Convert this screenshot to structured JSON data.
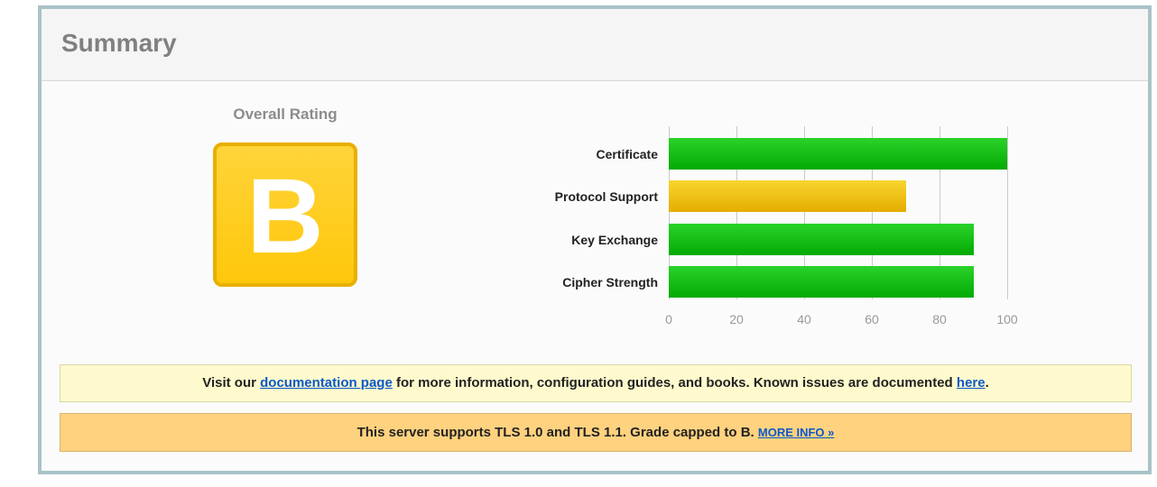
{
  "summary": {
    "title": "Summary",
    "overall_rating_label": "Overall Rating",
    "grade": "B",
    "grade_color": "#ffc70a"
  },
  "chart_data": {
    "type": "bar",
    "orientation": "horizontal",
    "categories": [
      "Certificate",
      "Protocol Support",
      "Key Exchange",
      "Cipher Strength"
    ],
    "values": [
      100,
      70,
      90,
      90
    ],
    "bar_colors": [
      "#16c016",
      "#f0c010",
      "#16c016",
      "#16c016"
    ],
    "xlim": [
      0,
      100
    ],
    "xticks": [
      0,
      20,
      40,
      60,
      80,
      100
    ],
    "grid": true,
    "title": "",
    "xlabel": "",
    "ylabel": ""
  },
  "notices": {
    "doc": {
      "prefix": "Visit our ",
      "link1": "documentation page",
      "middle": " for more information, configuration guides, and books. Known issues are documented ",
      "link2": "here",
      "suffix": "."
    },
    "tls": {
      "text": "This server supports TLS 1.0 and TLS 1.1. Grade capped to B. ",
      "link": "MORE INFO »"
    }
  }
}
